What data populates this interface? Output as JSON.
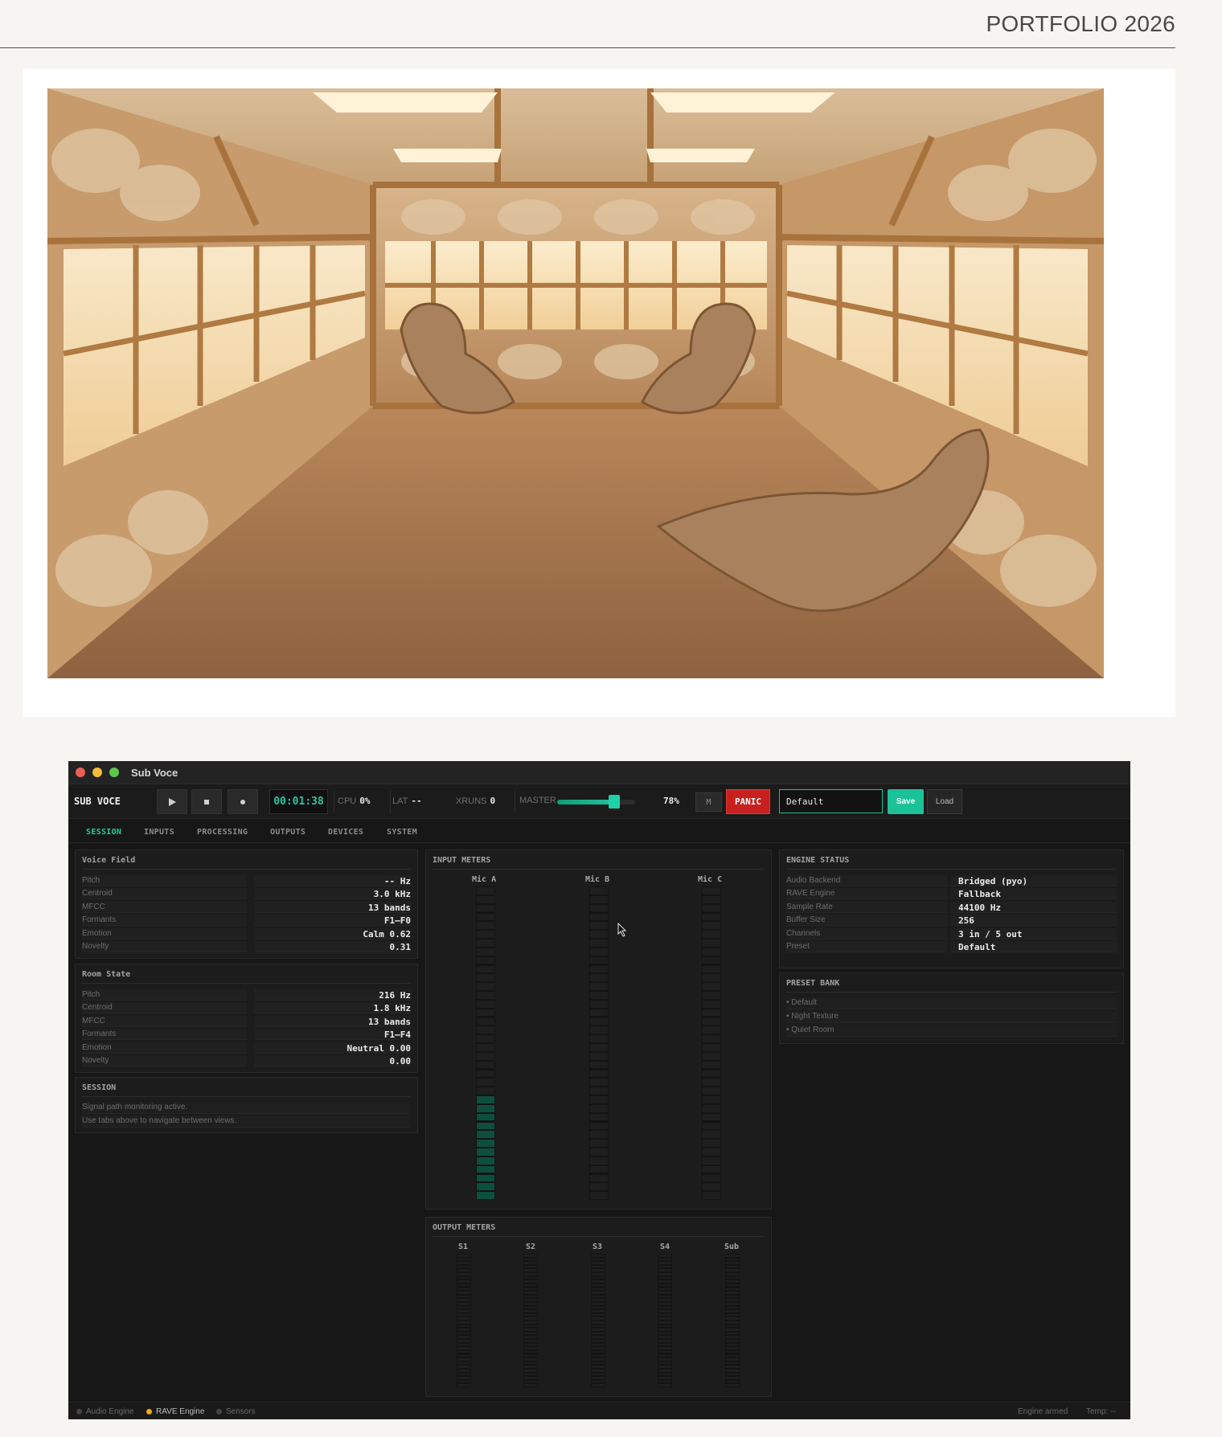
{
  "page": {
    "heading": "PORTFOLIO 2026"
  },
  "window": {
    "title": "Sub Voce",
    "controls": [
      "close",
      "minimize",
      "zoom"
    ]
  },
  "toolbar": {
    "brand": "SUB VOCE",
    "play_icon": "play-icon",
    "stop_icon": "stop-icon",
    "record_icon": "record-icon",
    "clock": "00:01:38",
    "cpu_label": "CPU",
    "cpu_value": "0%",
    "lat_label": "LAT",
    "lat_value": "--",
    "xruns_label": "XRUNS",
    "xruns_value": "0",
    "master_label": "MASTER",
    "master_level": 0.78,
    "master_value": "78%",
    "mute_label": "M",
    "panic_label": "PANIC",
    "preset_value": "Default",
    "save_label": "Save",
    "load_label": "Load"
  },
  "tabs": [
    {
      "label": "SESSION",
      "active": true
    },
    {
      "label": "INPUTS",
      "active": false
    },
    {
      "label": "PROCESSING",
      "active": false
    },
    {
      "label": "OUTPUTS",
      "active": false
    },
    {
      "label": "DEVICES",
      "active": false
    },
    {
      "label": "SYSTEM",
      "active": false
    }
  ],
  "voice_field": {
    "title": "Voice Field",
    "rows": [
      {
        "key": "Pitch",
        "value": "-- Hz"
      },
      {
        "key": "Centroid",
        "value": "3.0 kHz"
      },
      {
        "key": "MFCC",
        "value": "13 bands"
      },
      {
        "key": "Formants",
        "value": "F1–F0"
      },
      {
        "key": "Emotion",
        "value": "Calm 0.62"
      },
      {
        "key": "Novelty",
        "value": "0.31"
      }
    ]
  },
  "room_state": {
    "title": "Room State",
    "rows": [
      {
        "key": "Pitch",
        "value": "216 Hz"
      },
      {
        "key": "Centroid",
        "value": "1.8 kHz"
      },
      {
        "key": "MFCC",
        "value": "13 bands"
      },
      {
        "key": "Formants",
        "value": "F1–F4"
      },
      {
        "key": "Emotion",
        "value": "Neutral 0.00"
      },
      {
        "key": "Novelty",
        "value": "0.00"
      }
    ]
  },
  "session": {
    "title": "SESSION",
    "lines": [
      "Signal path monitoring active.",
      "Use tabs above to navigate between views."
    ]
  },
  "input_meters": {
    "title": "INPUT METERS",
    "channels": [
      {
        "name": "Mic A",
        "level": 0.32
      },
      {
        "name": "Mic B",
        "level": 0.0
      },
      {
        "name": "Mic C",
        "level": 0.0
      }
    ]
  },
  "output_meters": {
    "title": "OUTPUT METERS",
    "channels": [
      {
        "name": "S1",
        "level": 0.0
      },
      {
        "name": "S2",
        "level": 0.0
      },
      {
        "name": "S3",
        "level": 0.0
      },
      {
        "name": "S4",
        "level": 0.0
      },
      {
        "name": "Sub",
        "level": 0.0
      }
    ]
  },
  "engine_status": {
    "title": "ENGINE STATUS",
    "rows": [
      {
        "key": "Audio Backend",
        "value": "Bridged (pyo)"
      },
      {
        "key": "RAVE Engine",
        "value": "Fallback"
      },
      {
        "key": "Sample Rate",
        "value": "44100 Hz"
      },
      {
        "key": "Buffer Size",
        "value": "256"
      },
      {
        "key": "Channels",
        "value": "3 in / 5 out"
      },
      {
        "key": "Preset",
        "value": "Default"
      }
    ]
  },
  "preset_bank": {
    "title": "PRESET BANK",
    "items": [
      "• Default",
      "• Night Texture",
      "• Quiet Room"
    ]
  },
  "statusbar": {
    "audio_engine": "Audio Engine",
    "rave_engine": "RAVE Engine",
    "sensors": "Sensors",
    "engine_state": "Engine armed",
    "temp_label": "Temp:",
    "temp_value": "--",
    "colors": {
      "rave_dot": "#f3a91c",
      "idle_dot": "#444444"
    }
  },
  "colors": {
    "accent": "#1fcf9f",
    "panic": "#c8201f",
    "meter_on": "#0d4f3d"
  }
}
